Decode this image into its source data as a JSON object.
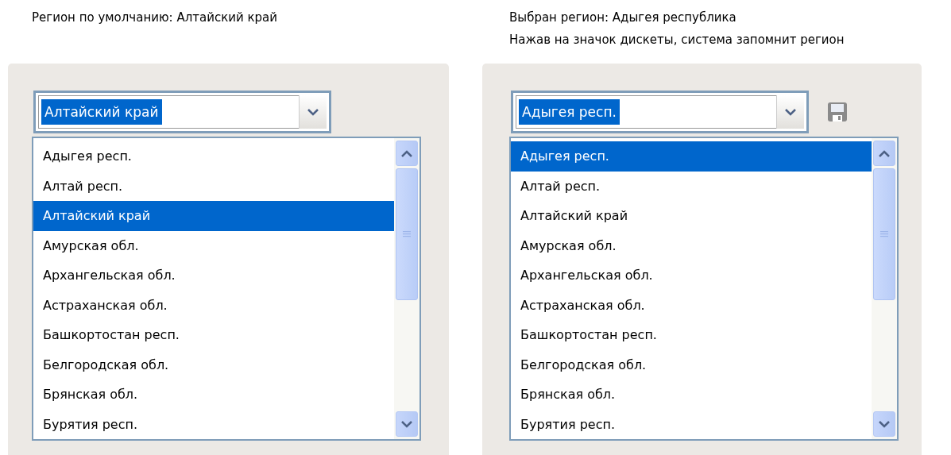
{
  "panels": [
    {
      "caption": [
        "Регион по умолчанию: Алтайский край"
      ],
      "combo": {
        "value": "Алтайский край"
      },
      "save_icon": false,
      "list": [
        {
          "label": "Адыгея респ.",
          "selected": false
        },
        {
          "label": "Алтай респ.",
          "selected": false
        },
        {
          "label": "Алтайский край",
          "selected": true
        },
        {
          "label": "Амурская обл.",
          "selected": false
        },
        {
          "label": "Архангельская обл.",
          "selected": false
        },
        {
          "label": "Астраханская обл.",
          "selected": false
        },
        {
          "label": "Башкортостан респ.",
          "selected": false
        },
        {
          "label": "Белгородская обл.",
          "selected": false
        },
        {
          "label": "Брянская обл.",
          "selected": false
        },
        {
          "label": "Бурятия респ.",
          "selected": false
        }
      ]
    },
    {
      "caption": [
        "Выбран регион: Адыгея республика",
        "Нажав на значок дискеты, система запомнит регион"
      ],
      "combo": {
        "value": "Адыгея респ."
      },
      "save_icon": true,
      "list": [
        {
          "label": "Адыгея респ.",
          "selected": true
        },
        {
          "label": "Алтай респ.",
          "selected": false
        },
        {
          "label": "Алтайский край",
          "selected": false
        },
        {
          "label": "Амурская обл.",
          "selected": false
        },
        {
          "label": "Архангельская обл.",
          "selected": false
        },
        {
          "label": "Астраханская обл.",
          "selected": false
        },
        {
          "label": "Башкортостан респ.",
          "selected": false
        },
        {
          "label": "Белгородская обл.",
          "selected": false
        },
        {
          "label": "Брянская обл.",
          "selected": false
        },
        {
          "label": "Бурятия респ.",
          "selected": false
        }
      ]
    }
  ]
}
